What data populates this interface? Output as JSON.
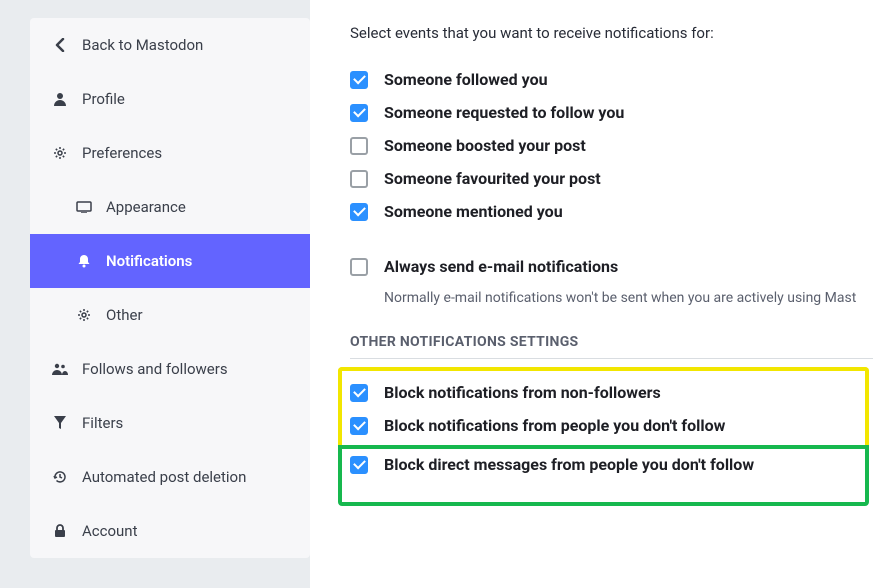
{
  "sidebar": {
    "back": "Back to Mastodon",
    "profile": "Profile",
    "preferences": "Preferences",
    "appearance": "Appearance",
    "notifications": "Notifications",
    "other": "Other",
    "follows": "Follows and followers",
    "filters": "Filters",
    "automated": "Automated post deletion",
    "account": "Account"
  },
  "main": {
    "intro": "Select events that you want to receive notifications for:",
    "options": {
      "followed": "Someone followed you",
      "requested": "Someone requested to follow you",
      "boosted": "Someone boosted your post",
      "favourited": "Someone favourited your post",
      "mentioned": "Someone mentioned you",
      "always_email": "Always send e-mail notifications",
      "always_email_sub": "Normally e-mail notifications won't be sent when you are actively using Mast"
    },
    "section_other": "OTHER NOTIFICATIONS SETTINGS",
    "block": {
      "non_followers": "Block notifications from non-followers",
      "not_following": "Block notifications from people you don't follow",
      "dm_not_following": "Block direct messages from people you don't follow"
    }
  }
}
